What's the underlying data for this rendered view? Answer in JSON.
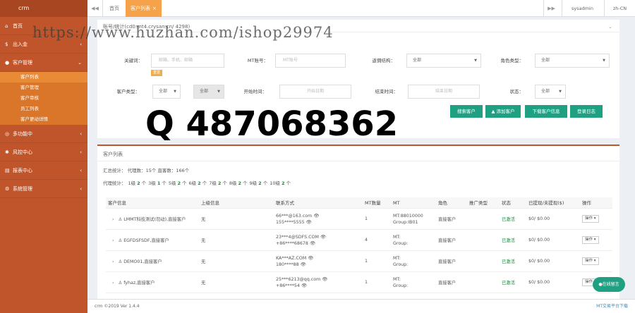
{
  "brand": "crm",
  "sidebar": {
    "groups": [
      {
        "label": "首页",
        "icon": "home-icon"
      },
      {
        "label": "出入金",
        "icon": "dollar-icon"
      },
      {
        "label": "客户管理",
        "icon": "user-icon"
      }
    ],
    "sub_items": [
      "客户列表",
      "客户管理",
      "客户审核",
      "员工列表",
      "客户更动详情"
    ],
    "groups2": [
      {
        "label": "多功能中",
        "icon": "compass-icon"
      },
      {
        "label": "风控中心",
        "icon": "shield-icon"
      },
      {
        "label": "报表中心",
        "icon": "chart-icon"
      },
      {
        "label": "系统管理",
        "icon": "gears-icon"
      }
    ]
  },
  "topbar": {
    "back": "◀◀",
    "tab_home": "首页",
    "tab_customers": "客户列表",
    "tab_close": "×",
    "forward": "▶▶",
    "user": "sysadmin",
    "lang": "zh-CN"
  },
  "filters": {
    "title": "账号/统计(cd0.mt4.crysan.cn/ 4298)",
    "keyword_label": "关键词：",
    "keyword_placeholder": "邮箱、手机、邮箱",
    "clear_tag": "重置",
    "mt_label": "MT账号：",
    "mt_placeholder": "MT账号",
    "structure_label": "返佣结构：",
    "structure_value": "全部",
    "role_label": "角色类型：",
    "role_value": "全部",
    "ctype_label": "客户类型：",
    "ctype_value1": "全部",
    "ctype_value2": "全部",
    "start_label": "开始时间：",
    "start_placeholder": "开始日期",
    "end_label": "结束时间：",
    "end_placeholder": "结束日期",
    "status_label": "状态：",
    "status_value": "全部",
    "buttons": [
      "搜索客户",
      "添加客户",
      "下载客户信息",
      "登录日志"
    ]
  },
  "list": {
    "title": "客户列表",
    "summary1": "汇总统计：  代理数：15个   直客数：166个",
    "summary2_prefix": "代理统计：",
    "levels": [
      {
        "pre": "1级",
        "n": "2",
        "suf": "个"
      },
      {
        "pre": "3级",
        "n": "1",
        "suf": "个"
      },
      {
        "pre": "5级",
        "n": "2",
        "suf": "个"
      },
      {
        "pre": "6级",
        "n": "2",
        "suf": "个"
      },
      {
        "pre": "7级",
        "n": "2",
        "suf": "个"
      },
      {
        "pre": "8级",
        "n": "2",
        "suf": "个"
      },
      {
        "pre": "9级",
        "n": "2",
        "suf": "个"
      },
      {
        "pre": "10级",
        "n": "2",
        "suf": "个"
      }
    ],
    "headers": [
      "客户信息",
      "上级信息",
      "联系方式",
      "MT数量",
      "MT",
      "角色",
      "推广类型",
      "状态",
      "已提现/未提现($)",
      "操作"
    ],
    "rows": [
      {
        "name": "LMMT科技测试(勿动),直接客户",
        "parent": "无",
        "contact1": "66***@163.com",
        "contact2": "155****5555",
        "mt_count": "1",
        "mt1": "MT:88010000",
        "mt2": "Group:IB01",
        "role": "直接客户",
        "ptype": "",
        "status": "已激活",
        "money": "$0/ $0.00",
        "op": "操作 ▾"
      },
      {
        "name": "EGFDSFSDF,直接客户",
        "parent": "无",
        "contact1": "23***4@SDFS.COM",
        "contact2": "+86****68678",
        "mt_count": "4",
        "mt1": "MT:",
        "mt2": "Group:",
        "role": "直接客户",
        "ptype": "",
        "status": "已激活",
        "money": "$0/ $0.00",
        "op": "操作 ▾"
      },
      {
        "name": "DEMO01,直接客户",
        "parent": "无",
        "contact1": "KA***AZ.COM",
        "contact2": "180****88",
        "mt_count": "1",
        "mt1": "MT:",
        "mt2": "Group:",
        "role": "直接客户",
        "ptype": "",
        "status": "已激活",
        "money": "$0/ $0.00",
        "op": "操作 ▾"
      },
      {
        "name": "fyhaz,直接客户",
        "parent": "无",
        "contact1": "25***6213@qq.com",
        "contact2": "+86****54",
        "mt_count": "1",
        "mt1": "MT:",
        "mt2": "Group:",
        "role": "直接客户",
        "ptype": "",
        "status": "已激活",
        "money": "$0/ $0.00",
        "op": "操作 ▾"
      }
    ]
  },
  "footer": {
    "copyright": "crm ©2019 Ver 1.4.4",
    "right": "MT交易平台下载"
  },
  "chat_button": "在线留言",
  "watermark": {
    "line1": "https://www.huzhan.com/ishop29974",
    "line2": "Q 487068362"
  }
}
